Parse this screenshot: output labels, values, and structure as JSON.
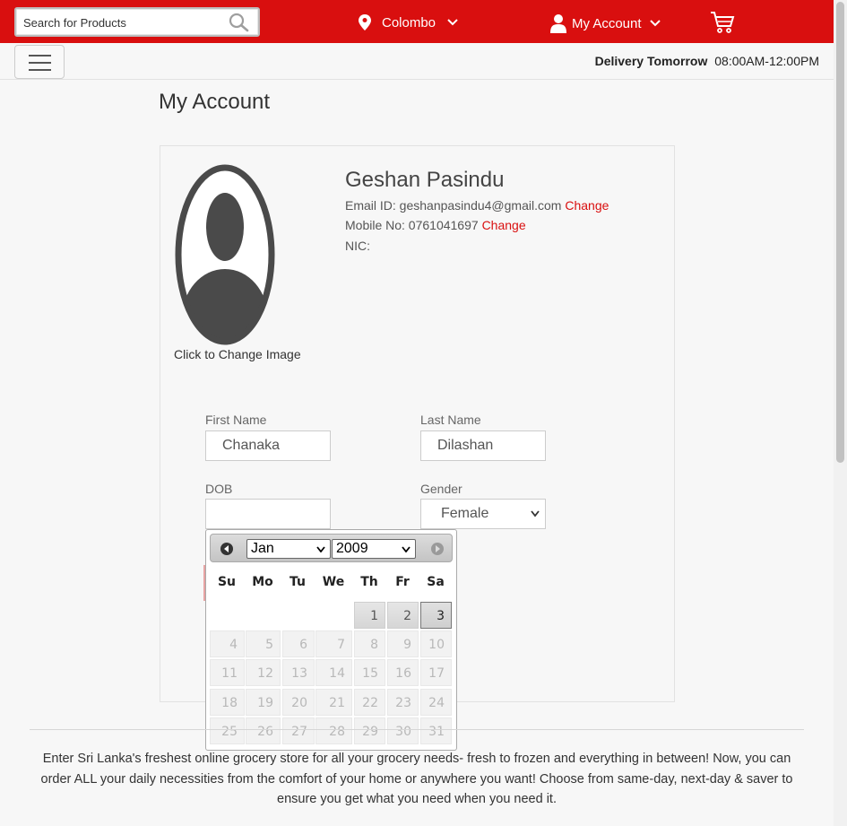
{
  "header": {
    "search_placeholder": "Search for Products",
    "location": "Colombo",
    "account_label": "My Account",
    "brand_color": "#d90f0f"
  },
  "subheader": {
    "delivery_label": "Delivery Tomorrow",
    "delivery_time": "08:00AM-12:00PM"
  },
  "page": {
    "title": "My Account"
  },
  "profile": {
    "change_image_label": "Click to Change Image",
    "name": "Geshan Pasindu",
    "email_prefix": "Email ID: geshanpasindu4@gmail.com",
    "email_change": "Change",
    "mobile_prefix": "Mobile No: 0761041697",
    "mobile_change": "Change",
    "nic_label": "NIC:"
  },
  "form": {
    "first_name_label": "First Name",
    "first_name_value": "Chanaka",
    "last_name_label": "Last Name",
    "last_name_value": "Dilashan",
    "dob_label": "DOB",
    "dob_value": "",
    "gender_label": "Gender",
    "gender_value": "Female"
  },
  "datepicker": {
    "month": "Jan",
    "year": "2009",
    "weekdays": [
      "Su",
      "Mo",
      "Tu",
      "We",
      "Th",
      "Fr",
      "Sa"
    ],
    "selected_day": "3",
    "days": {
      "d1": "1",
      "d2": "2",
      "d3": "3",
      "d4": "4",
      "d5": "5",
      "d6": "6",
      "d7": "7",
      "d8": "8",
      "d9": "9",
      "d10": "10",
      "d11": "11",
      "d12": "12",
      "d13": "13",
      "d14": "14",
      "d15": "15",
      "d16": "16",
      "d17": "17",
      "d18": "18",
      "d19": "19",
      "d20": "20",
      "d21": "21",
      "d22": "22",
      "d23": "23",
      "d24": "24",
      "d25": "25",
      "d26": "26",
      "d27": "27",
      "d28": "28",
      "d29": "29",
      "d30": "30",
      "d31": "31"
    }
  },
  "footer": {
    "text": "Enter Sri Lanka's freshest online grocery store for all your grocery needs- fresh to frozen and everything in between! Now, you can order ALL your daily necessities from the comfort of your home or anywhere you want! Choose from same-day, next-day & saver to ensure you get what you need when you need it."
  }
}
